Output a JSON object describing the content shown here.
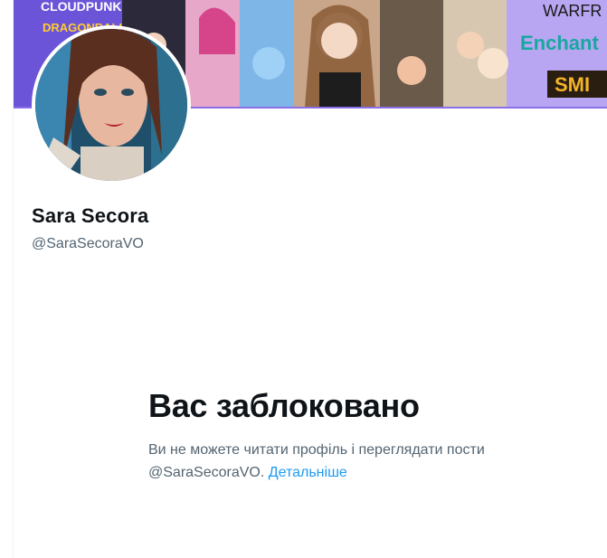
{
  "profile": {
    "display_name": "Sara Secora",
    "handle": "@SaraSecoraVO"
  },
  "banner": {
    "texts": [
      "CLOUDPUNK",
      "DRAGONBALL",
      "WARFR",
      "Enchant",
      "SMI"
    ]
  },
  "blocked": {
    "title": "Вас заблоковано",
    "message_line1": "Ви не можете читати профіль і переглядати пости",
    "message_line2_prefix": "@SaraSecoraVO. ",
    "learn_more": "Детальніше"
  },
  "colors": {
    "accent_link": "#1d9bf0",
    "text_primary": "#0f1419",
    "text_secondary": "#536471"
  },
  "icons": {
    "avatar": "profile-photo",
    "banner": "header-collage"
  }
}
